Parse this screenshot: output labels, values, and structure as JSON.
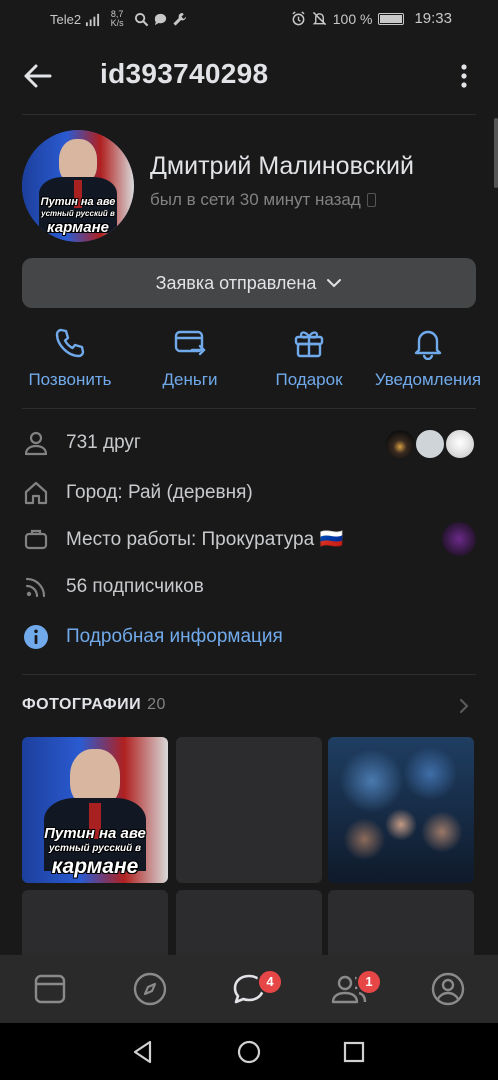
{
  "status_bar": {
    "carrier": "Tele2",
    "net_speed_value": "8,7",
    "net_speed_unit": "K/s",
    "battery": "100 %",
    "battery_level": 1.0,
    "time": "19:33"
  },
  "header": {
    "title": "id393740298"
  },
  "profile": {
    "name": "Дмитрий Малиновский",
    "last_seen": "был в сети 30 минут назад",
    "avatar_text": {
      "line1": "Путин на аве",
      "line2": "устный русский в",
      "line3": "кармане"
    }
  },
  "request_button": {
    "label": "Заявка отправлена"
  },
  "actions": [
    {
      "label": "Позвонить",
      "icon": "phone-icon"
    },
    {
      "label": "Деньги",
      "icon": "money-card-icon"
    },
    {
      "label": "Подарок",
      "icon": "gift-icon"
    },
    {
      "label": "Уведомления",
      "icon": "bell-icon"
    }
  ],
  "info": {
    "friends": "731 друг",
    "city": "Город: Рай (деревня)",
    "work": "Место работы: Прокуратура 🇷🇺",
    "followers": "56 подписчиков",
    "details_link": "Подробная информация"
  },
  "photos": {
    "title": "ФОТОГРАФИИ",
    "count": "20",
    "meme_text": {
      "line1": "Путин на аве",
      "line2": "устный русский в",
      "line3": "кармане"
    }
  },
  "bottom_nav": {
    "messages_badge": "4",
    "friends_badge": "1"
  },
  "colors": {
    "accent": "#71aaeb",
    "background": "#19191a",
    "badge": "#e64646"
  }
}
